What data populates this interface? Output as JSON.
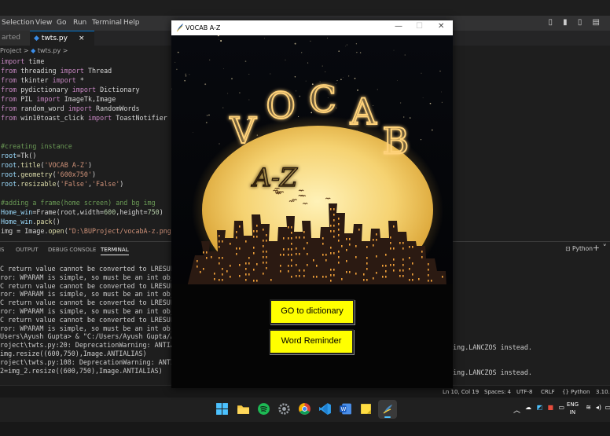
{
  "menubar": {
    "items": [
      "Selection",
      "View",
      "Go",
      "Run",
      "Terminal",
      "Help"
    ],
    "layout_icons": "▯ ▮ ▯ ▤"
  },
  "tabs": [
    {
      "label": "arted"
    },
    {
      "label": "twts.py",
      "close": "×"
    }
  ],
  "breadcrumb": {
    "folder": "Project",
    "sep": ">",
    "file": "twts.py",
    "sep2": ">"
  },
  "code_lines": [
    "import time",
    "from threading import Thread",
    "from tkinter import *",
    "from pydictionary import Dictionary",
    "from PIL import ImageTk,Image",
    "from random_word import RandomWords",
    "from win10toast_click import ToastNotifier",
    "",
    "",
    "#creating instance",
    "root=Tk()",
    "root.title('VOCAB A-Z')",
    "root.geometry('600x750')",
    "root.resizable('False','False')",
    "",
    "#adding a frame(home screen) and bg img",
    "Home_win=Frame(root,width=600,height=750)",
    "Home_win.pack()",
    "img = Image.open(\"D:\\BUProject/vocabA-z.png\")"
  ],
  "panel": {
    "tabs": [
      "MS",
      "OUTPUT",
      "DEBUG CONSOLE",
      "TERMINAL"
    ],
    "python_label": "Python",
    "plus": "+ ˅"
  },
  "terminal_lines": [
    "C return value cannot be converted to LRESULT",
    "ror: WPARAM is simple, so must be an int objec",
    "C return value cannot be converted to LRESULT",
    "ror: WPARAM is simple, so must be an int objec",
    "C return value cannot be converted to LRESULT",
    "ror: WPARAM is simple, so must be an int objec",
    "C return value cannot be converted to LRESULT",
    "ror: WPARAM is simple, so must be an int objec",
    "Users\\Ayush Gupta> & \"C:/Users/Ayush Gupta/App",
    "roject\\twts.py:20: DeprecationWarning: ANTIALI",
    "img.resize((600,750),Image.ANTIALIAS)",
    "roject\\twts.py:108: DeprecationWarning: ANTIAL",
    "2=img_2.resize((600,750),Image.ANTIALIAS)"
  ],
  "terminal_right": [
    "sling.LANCZOS instead.",
    "",
    "",
    "sling.LANCZOS instead."
  ],
  "statusbar": {
    "position": "Ln 10, Col 19",
    "spaces": "Spaces: 4",
    "encoding": "UTF-8",
    "eol": "CRLF",
    "language": "{} Python",
    "version": "3.10.6"
  },
  "tray": {
    "lang_top": "ENG",
    "lang_bottom": "IN"
  },
  "app": {
    "title": "VOCAB A-Z",
    "min": "—",
    "max": "☐",
    "close": "✕",
    "logo_word": "VOCAB",
    "logo_sub": "A-Z",
    "buttons": {
      "dictionary": "GO to dictionary",
      "word_reminder": "Word Reminder"
    },
    "colors": {
      "button_bg": "#ffff00",
      "moon": "#f5d271",
      "neon": "#ffd27a"
    }
  }
}
